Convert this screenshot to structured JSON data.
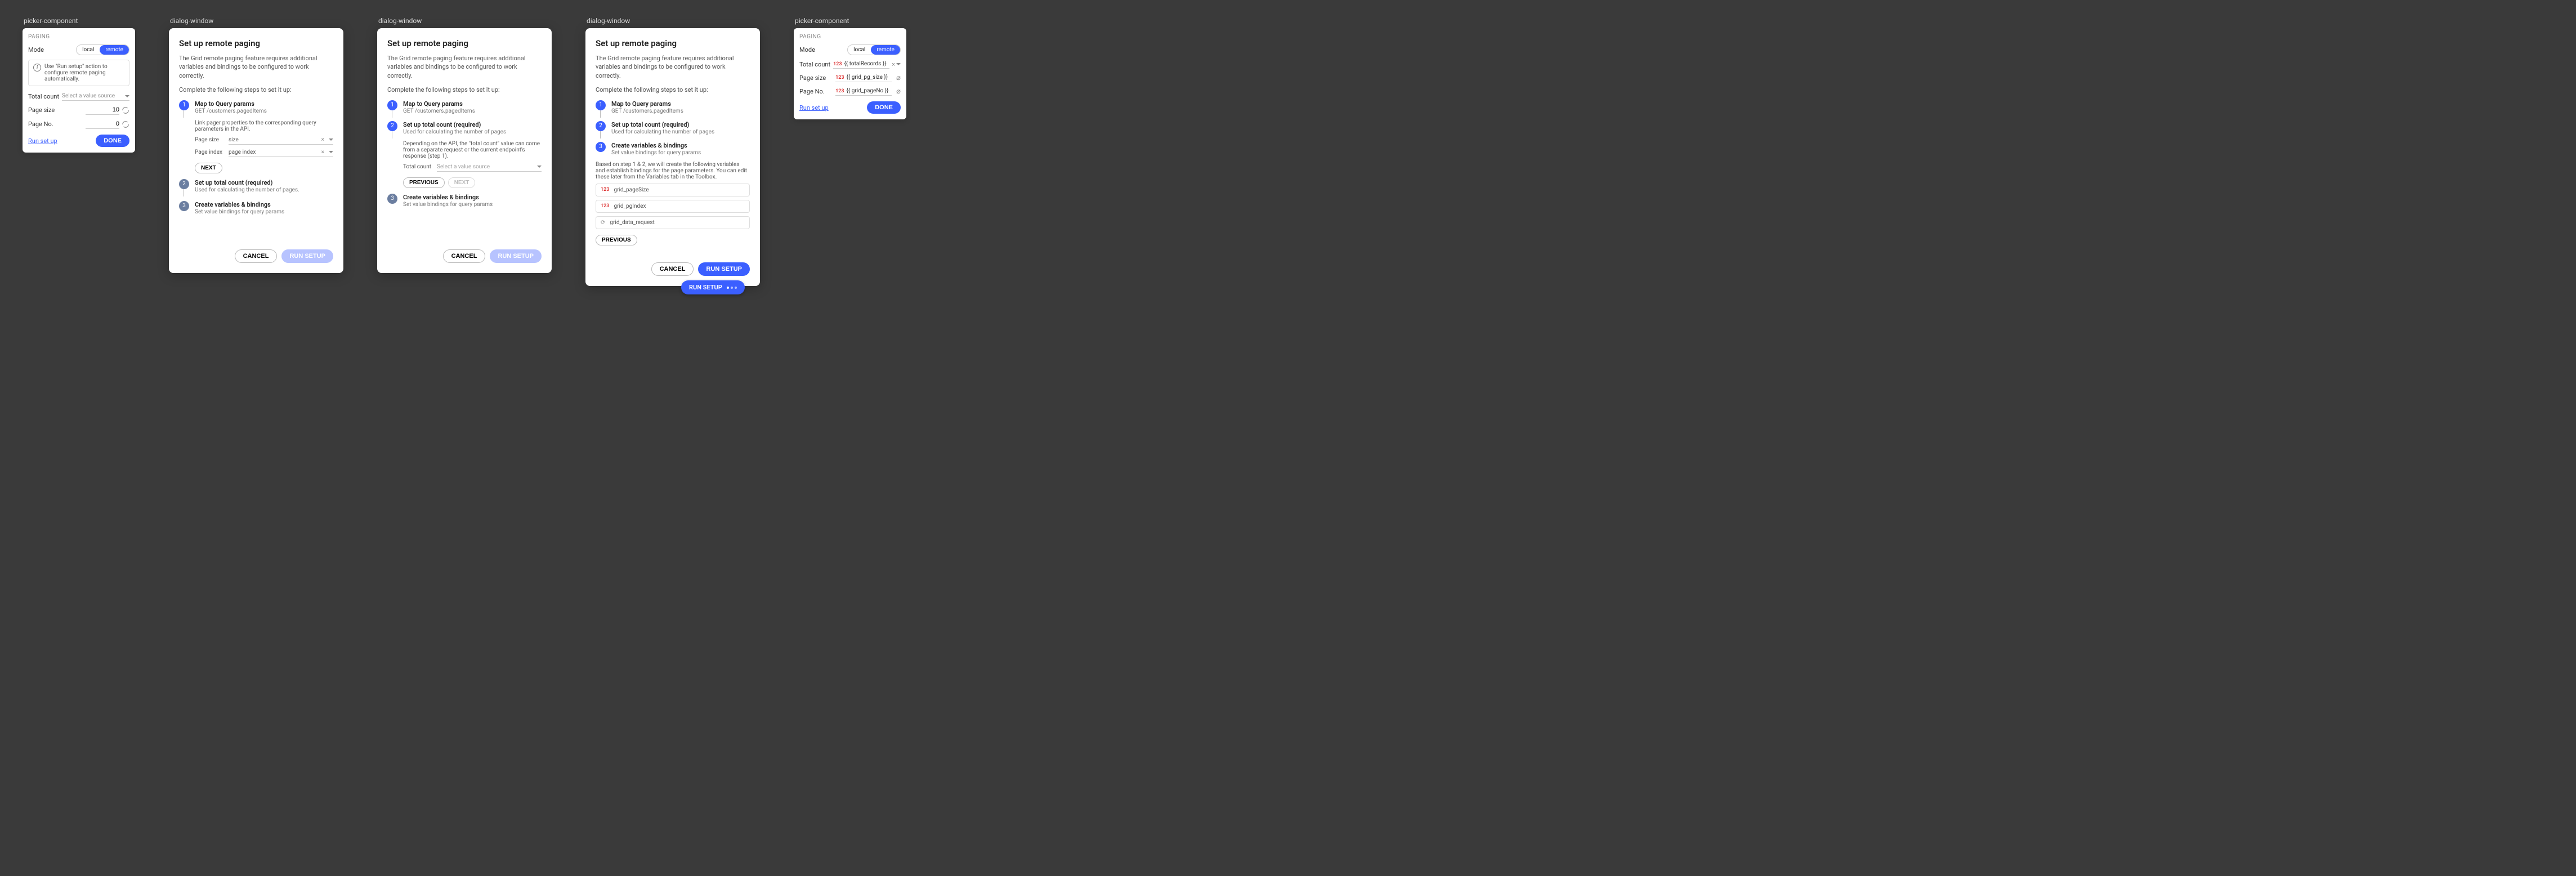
{
  "labels": {
    "picker_component": "picker-component",
    "dialog_window": "dialog-window"
  },
  "picker1": {
    "section": "PAGING",
    "mode_label": "Mode",
    "mode_local": "local",
    "mode_remote": "remote",
    "info": "Use \"Run setup\" action to configure remote paging automatically.",
    "total_count_label": "Total count",
    "total_count_placeholder": "Select a value source",
    "page_size_label": "Page size",
    "page_size_value": "10",
    "page_no_label": "Page No.",
    "page_no_value": "0",
    "run_setup": "Run set up",
    "done": "DONE"
  },
  "picker2": {
    "section": "PAGING",
    "mode_label": "Mode",
    "mode_local": "local",
    "mode_remote": "remote",
    "total_count_label": "Total count",
    "total_count_value": "{{ totalRecords }}",
    "page_size_label": "Page size",
    "page_size_value": "{{ grid_pg_size }}",
    "page_no_label": "Page No.",
    "page_no_value": "{{ grid_pageNo }}",
    "run_setup": "Run set up",
    "done": "DONE"
  },
  "dialog": {
    "title": "Set up remote paging",
    "intro": "The Grid remote paging feature requires additional variables and bindings to be configured to work correctly.",
    "instruction": "Complete the following steps to set it up:",
    "cancel": "CANCEL",
    "run": "RUN SETUP",
    "steps": {
      "s1": {
        "title": "Map to Query params",
        "sub": "GET /customers.pagedItems"
      },
      "s2": {
        "title": "Set up total count (required)",
        "sub": "Used for calculating the number of pages"
      },
      "s2b": {
        "sub": "Used for calculating the number of pages."
      },
      "s3": {
        "title": "Create variables & bindings",
        "sub": "Set value bindings for query params"
      }
    },
    "step1_body": "Link pager properties to the corresponding query parameters in the API.",
    "step1_page_size_label": "Page size",
    "step1_page_size_value": "size",
    "step1_page_index_label": "Page index",
    "step1_page_index_value": "page index",
    "step2_body": "Depending on the API, the \"total count\" value can come from a separate request or the current endpoint's response (step 1).",
    "step2_total_count_label": "Total count",
    "step2_total_count_placeholder": "Select a value source",
    "step3_body": "Based on step 1 & 2, we will create the following variables and establish bindings for the page parameters. You can edit these later from the Variables tab in the Toolbox.",
    "step3_var1": "grid_pageSize",
    "step3_var2": "grid_pgIndex",
    "step3_var3": "grid_data_request",
    "next": "NEXT",
    "previous": "PREVIOUS"
  },
  "chip": {
    "label": "RUN SETUP"
  },
  "badge_num": "123"
}
